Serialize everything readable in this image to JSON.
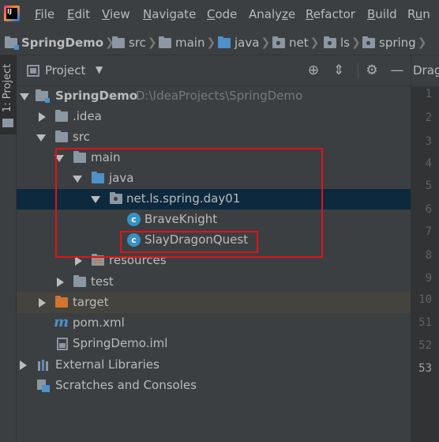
{
  "menu": {
    "items": [
      {
        "label": "File",
        "u": "F"
      },
      {
        "label": "Edit",
        "u": "E"
      },
      {
        "label": "View",
        "u": "V"
      },
      {
        "label": "Navigate",
        "u": "N"
      },
      {
        "label": "Code",
        "u": "C"
      },
      {
        "label": "Analyze",
        "u": "z"
      },
      {
        "label": "Refactor",
        "u": "R"
      },
      {
        "label": "Build",
        "u": "B"
      },
      {
        "label": "Run",
        "u": "u"
      }
    ]
  },
  "breadcrumb": [
    "SpringDemo",
    "src",
    "main",
    "java",
    "net",
    "ls",
    "spring"
  ],
  "toolstrip": {
    "label": "1: Project"
  },
  "panel": {
    "title": "Project"
  },
  "editor": {
    "tab_label": "Drag",
    "line_numbers": [
      "1",
      "2",
      "3",
      "4",
      "5",
      "6",
      "7",
      "8",
      "9",
      "10",
      "51",
      "52",
      "53"
    ]
  },
  "tree": {
    "root_name": "SpringDemo",
    "root_path": "D:\\IdeaProjects\\SpringDemo",
    "idea": ".idea",
    "src": "src",
    "main": "main",
    "java": "java",
    "package": "net.ls.spring.day01",
    "class1": "BraveKnight",
    "class2": "SlayDragonQuest",
    "resources": "resources",
    "test": "test",
    "target": "target",
    "pom": "pom.xml",
    "iml": "SpringDemo.iml",
    "libraries": "External Libraries",
    "scratches": "Scratches and Consoles"
  },
  "colors": {
    "annotation": "#e0121b",
    "selection": "#0d293e",
    "class_icon": "#3592c4",
    "folder_blue": "#4e90c8",
    "folder_orange": "#d0742e"
  }
}
